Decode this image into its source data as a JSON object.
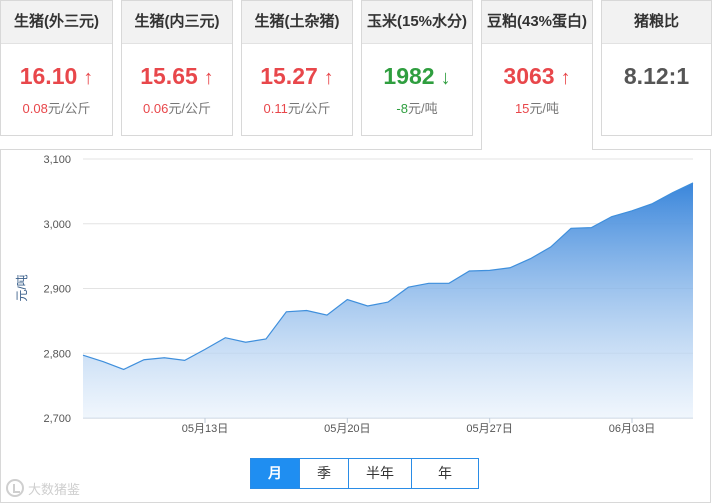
{
  "cards": [
    {
      "title": "生猪(外三元)",
      "price": "16.10",
      "arrow": "↑",
      "trend": "up",
      "change": "0.08",
      "unit": "元/公斤"
    },
    {
      "title": "生猪(内三元)",
      "price": "15.65",
      "arrow": "↑",
      "trend": "up",
      "change": "0.06",
      "unit": "元/公斤"
    },
    {
      "title": "生猪(土杂猪)",
      "price": "15.27",
      "arrow": "↑",
      "trend": "up",
      "change": "0.11",
      "unit": "元/公斤"
    },
    {
      "title": "玉米(15%水分)",
      "price": "1982",
      "arrow": "↓",
      "trend": "down",
      "change": "-8",
      "unit": "元/吨"
    },
    {
      "title": "豆粕(43%蛋白)",
      "price": "3063",
      "arrow": "↑",
      "trend": "up",
      "change": "15",
      "unit": "元/吨",
      "active": true
    },
    {
      "title": "猪粮比",
      "price": "8.12:1",
      "arrow": "",
      "trend": "neutral",
      "change": "",
      "unit": ""
    }
  ],
  "colors": {
    "up": "#e8474b",
    "down": "#2f9e3f",
    "accent": "#1f8ef1",
    "line": "#3f8fdc"
  },
  "ranges": {
    "month": "月",
    "season": "季",
    "half_year": "半年",
    "year": "年",
    "selected": "month"
  },
  "watermark": "大数猪鉴",
  "chart_data": {
    "type": "area",
    "title": "",
    "xlabel": "",
    "ylabel": "元/吨",
    "ylim": [
      2700,
      3100
    ],
    "yticks": [
      2700,
      2800,
      2900,
      3000,
      3100
    ],
    "ytick_labels": [
      "2,700",
      "2,800",
      "2,900",
      "3,000",
      "3,100"
    ],
    "x_tick_labels": [
      "05月13日",
      "05月20日",
      "05月27日",
      "06月03日"
    ],
    "x_tick_dates": [
      "2019-05-13",
      "2019-05-20",
      "2019-05-27",
      "2019-06-03"
    ],
    "grid": true,
    "series": [
      {
        "x": [
          "2019-05-07",
          "2019-05-08",
          "2019-05-09",
          "2019-05-10",
          "2019-05-11",
          "2019-05-12",
          "2019-05-13",
          "2019-05-14",
          "2019-05-15",
          "2019-05-16",
          "2019-05-17",
          "2019-05-18",
          "2019-05-19",
          "2019-05-20",
          "2019-05-21",
          "2019-05-22",
          "2019-05-23",
          "2019-05-24",
          "2019-05-25",
          "2019-05-26",
          "2019-05-27",
          "2019-05-28",
          "2019-05-29",
          "2019-05-30",
          "2019-05-31",
          "2019-06-01",
          "2019-06-02",
          "2019-06-03",
          "2019-06-04",
          "2019-06-05",
          "2019-06-06"
        ],
        "values": [
          2797,
          2787,
          2775,
          2790,
          2793,
          2789,
          2806,
          2824,
          2817,
          2822,
          2864,
          2866,
          2859,
          2883,
          2873,
          2879,
          2902,
          2908,
          2908,
          2927,
          2928,
          2932,
          2946,
          2964,
          2993,
          2994,
          3011,
          3020,
          3031,
          3048,
          3063
        ]
      }
    ]
  }
}
